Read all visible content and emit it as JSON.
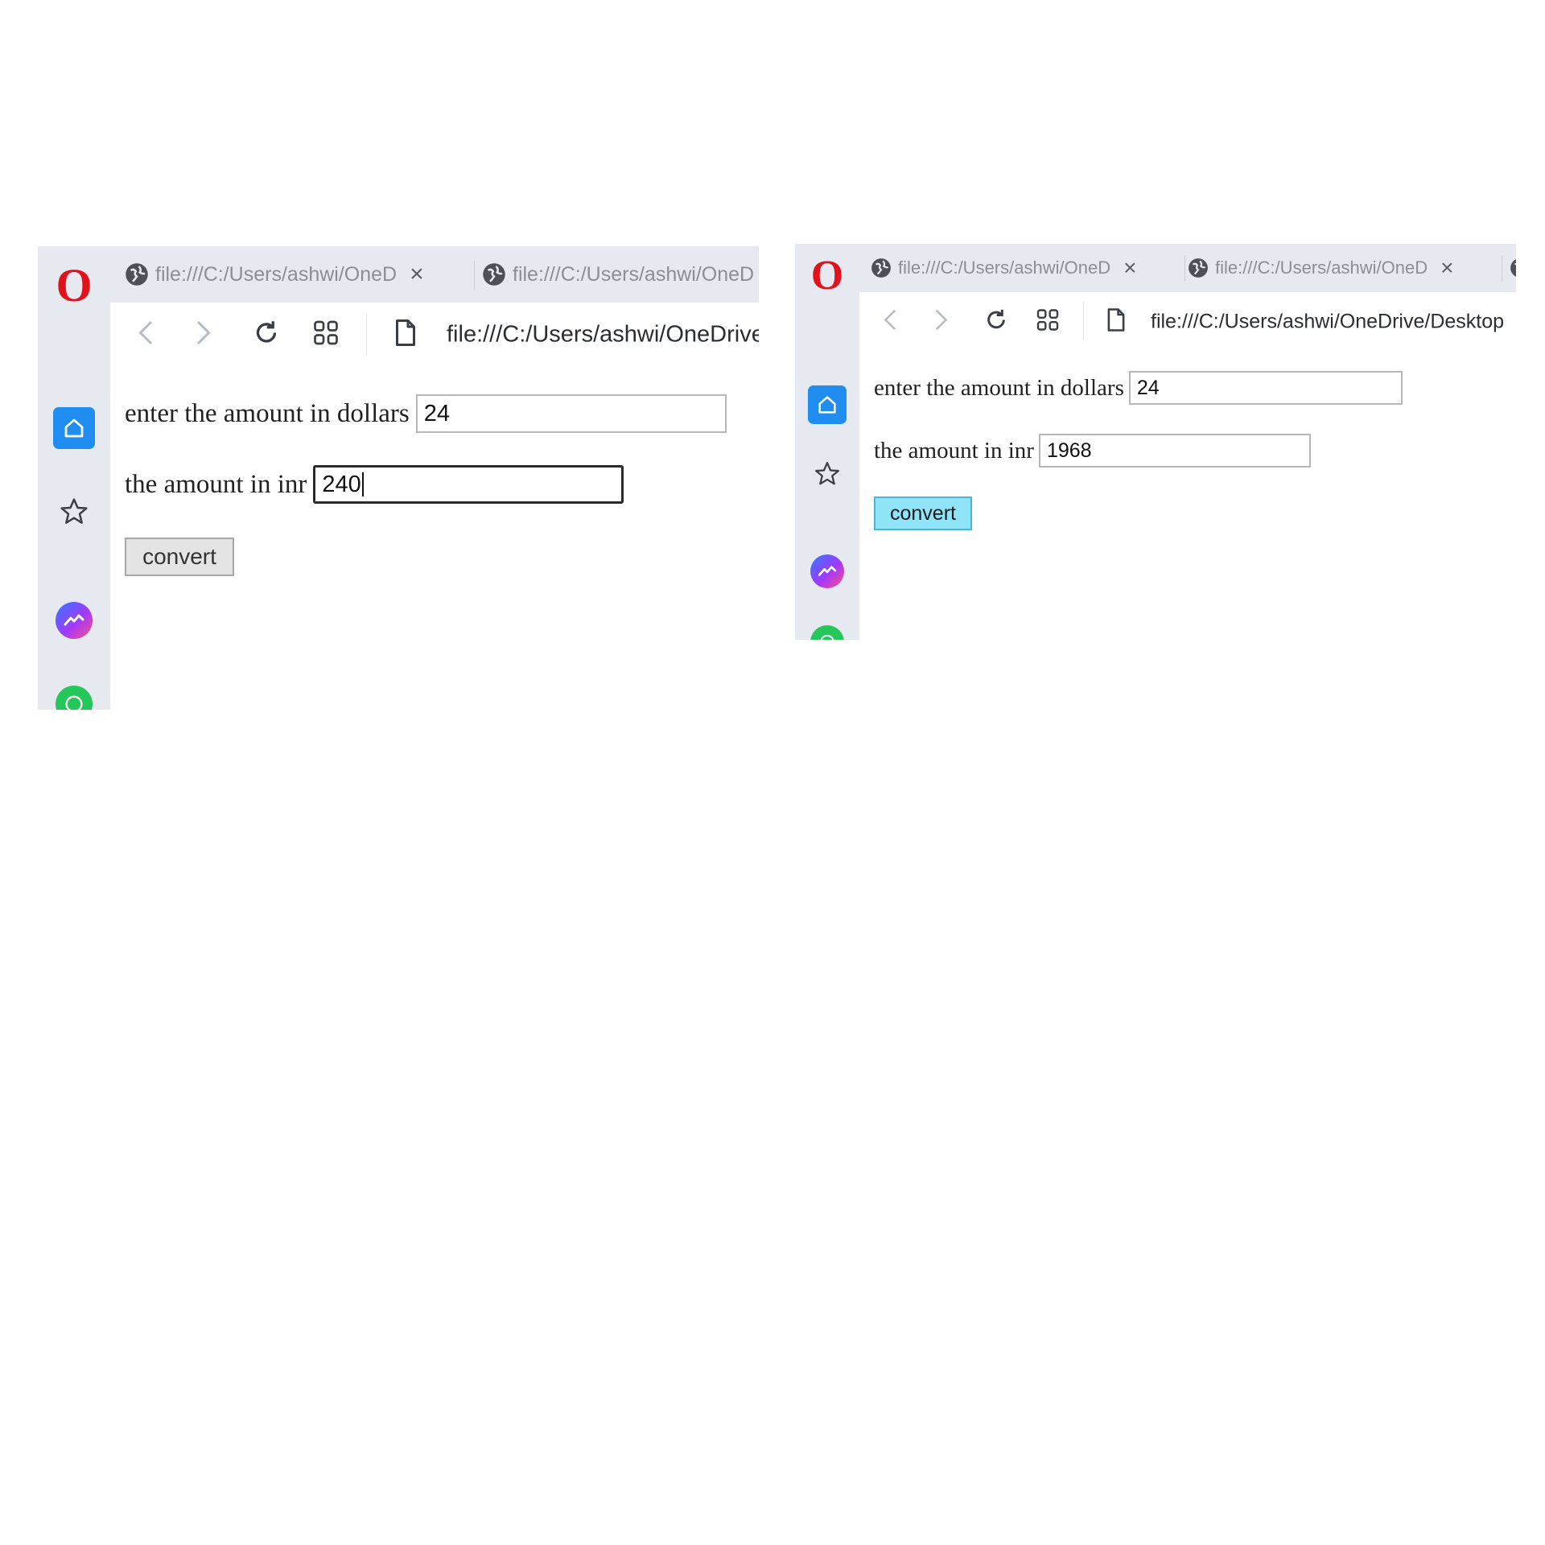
{
  "screenshots": [
    {
      "tabs": [
        {
          "title": "file:///C:/Users/ashwi/OneD",
          "close": "×"
        },
        {
          "title": "file:///C:/Users/ashwi/OneD"
        }
      ],
      "url": "file:///C:/Users/ashwi/OneDrive",
      "form": {
        "dollars_label": "enter the amount in dollars",
        "dollars_value": "24",
        "inr_label": "the amount in inr",
        "inr_value": "240",
        "convert_label": "convert"
      }
    },
    {
      "tabs": [
        {
          "title": "file:///C:/Users/ashwi/OneD",
          "close": "×"
        },
        {
          "title": "file:///C:/Users/ashwi/OneD",
          "close": "×"
        }
      ],
      "url": "file:///C:/Users/ashwi/OneDrive/Desktop",
      "form": {
        "dollars_label": "enter the amount in dollars",
        "dollars_value": "24",
        "inr_label": "the amount in inr",
        "inr_value": "1968",
        "convert_label": "convert"
      }
    }
  ],
  "icons": {
    "browser_logo": "opera-logo",
    "sidebar": [
      "home-icon",
      "star-icon",
      "messenger-icon",
      "whatsapp-icon"
    ],
    "toolbar": [
      "back-icon",
      "forward-icon",
      "reload-icon",
      "speed-dial-icon",
      "page-icon"
    ],
    "opera_logo_glyph": "O"
  },
  "colors": {
    "opera_red": "#e0121b",
    "home_blue": "#1f8ef0",
    "convert_active": "#8fe4f8",
    "whatsapp_green": "#25c75a"
  }
}
